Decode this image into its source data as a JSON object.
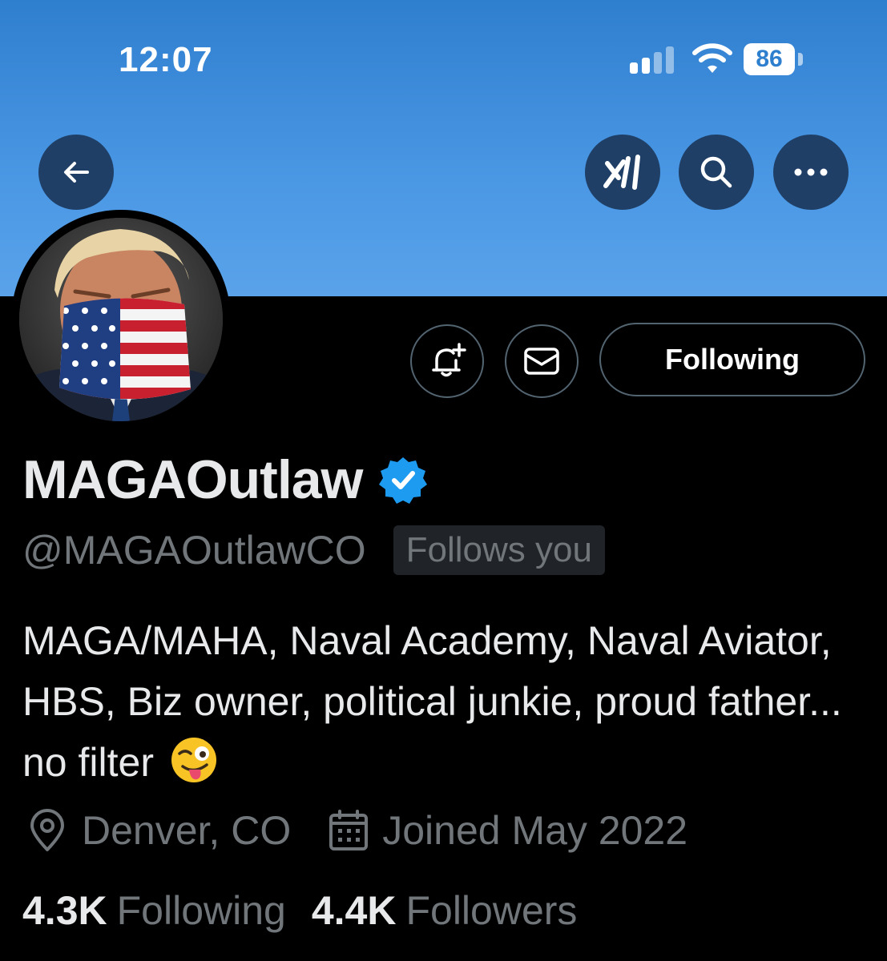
{
  "status_bar": {
    "time": "12:07",
    "battery": "86"
  },
  "header_icons": [
    "back-arrow-icon",
    "grok-icon",
    "search-icon",
    "more-icon"
  ],
  "profile": {
    "display_name": "MAGAOutlaw",
    "handle": "@MAGAOutlawCO",
    "follows_you_label": "Follows you",
    "bio": "MAGA/MAHA, Naval Academy, Naval Aviator, HBS, Biz owner, political junkie, proud father... no filter",
    "location": "Denver, CO",
    "joined": "Joined May 2022",
    "following_count": "4.3K",
    "following_label": "Following",
    "followers_count": "4.4K",
    "followers_label": "Followers"
  },
  "actions": {
    "follow_button_label": "Following"
  },
  "colors": {
    "banner": "#4a97e4",
    "verified": "#1d9bf0",
    "muted_text": "#71767b"
  }
}
